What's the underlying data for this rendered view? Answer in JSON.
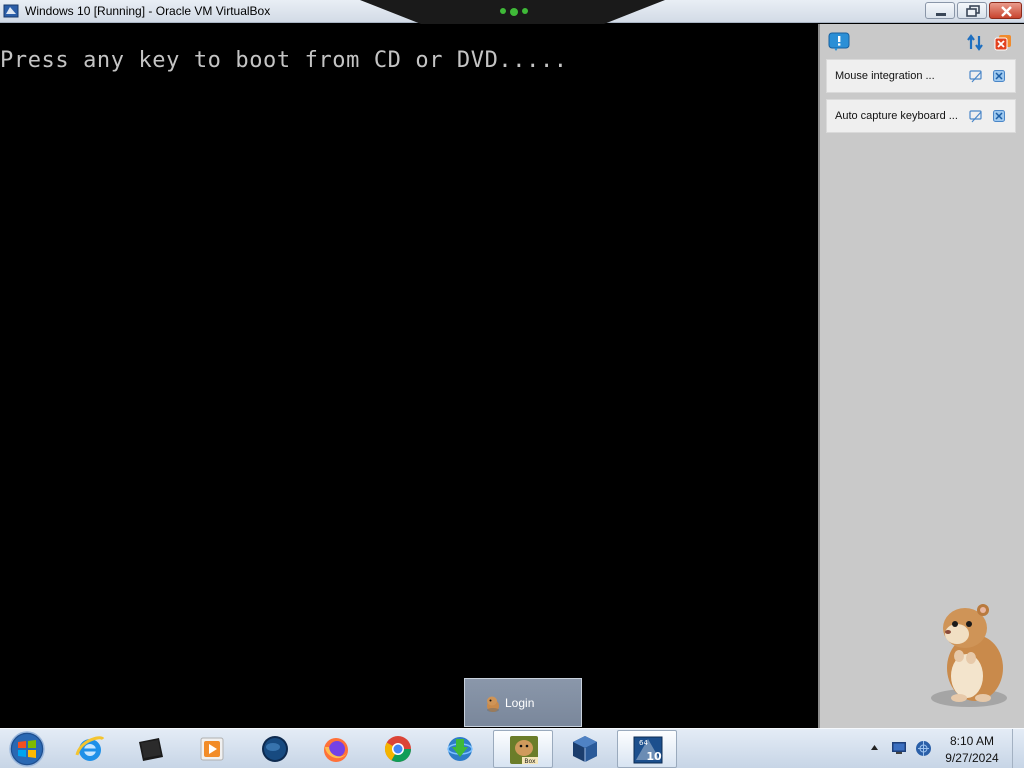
{
  "window": {
    "title": "Windows 10 [Running] - Oracle VM VirtualBox",
    "app_icon": "virtualbox-vm-icon",
    "controls": [
      "minimize-icon",
      "restore-icon",
      "close-icon"
    ]
  },
  "guest": {
    "boot_message": "Press any key to boot from CD or DVD....."
  },
  "notifications": {
    "header_icons": [
      "help-icon",
      "sort-arrows-icon",
      "close-all-icon"
    ],
    "items": [
      {
        "text": "Mouse integration ...",
        "actions": [
          "do-not-show-icon",
          "close-icon"
        ]
      },
      {
        "text": "Auto capture keyboard ...",
        "actions": [
          "do-not-show-icon",
          "close-icon"
        ]
      }
    ],
    "mascot": "hamster-mascot"
  },
  "popup": {
    "label": "Login",
    "icon": "hamster-small-icon"
  },
  "taskbar": {
    "start": "windows-start-orb",
    "apps": [
      "internet-explorer-icon",
      "terminal-icon",
      "media-player-icon",
      "globe-icon",
      "firefox-icon",
      "chrome-icon",
      "internet-download-manager-icon",
      "hamster-box-icon",
      "virtualbox-manager-icon",
      "windows10-vm-icon"
    ],
    "badges": {
      "hamster_box": "Box",
      "vm_arch": "64",
      "vm_version": "10"
    },
    "tray": [
      "tray-chevron-icon",
      "monitor-icon",
      "network-icon"
    ],
    "clock": {
      "time": "8:10 AM",
      "date": "9/27/2024"
    }
  },
  "colors": {
    "boot_text": "#c4c4c4",
    "panel_bg": "#c9c9c9",
    "notice_bg": "#efefef",
    "close_button": "#c8442e",
    "taskbar": "#d6e1ee"
  }
}
